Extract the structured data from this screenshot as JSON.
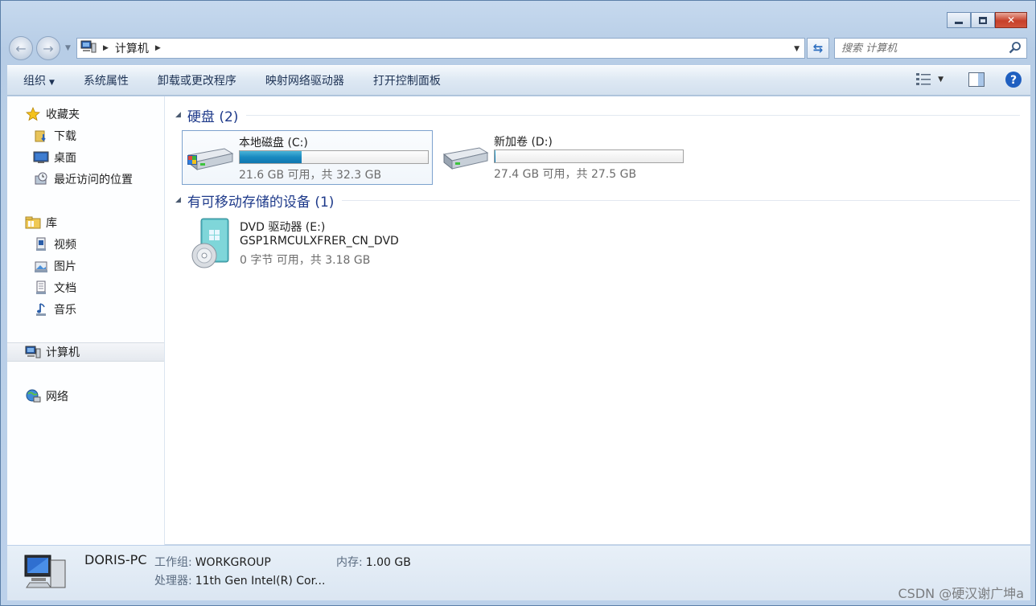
{
  "window": {
    "controls": {
      "minimize": "minimize",
      "maximize": "maximize",
      "close": "✕"
    }
  },
  "address": {
    "location": "计算机",
    "icon": "computer-icon"
  },
  "search": {
    "placeholder": "搜索 计算机"
  },
  "toolbar": {
    "organize": "组织",
    "system_properties": "系统属性",
    "uninstall": "卸载或更改程序",
    "map_drive": "映射网络驱动器",
    "control_panel": "打开控制面板"
  },
  "sidebar": {
    "favorites": {
      "label": "收藏夹",
      "icon": "star-icon"
    },
    "favorites_items": [
      {
        "label": "下载",
        "icon": "downloads-folder-icon"
      },
      {
        "label": "桌面",
        "icon": "desktop-icon"
      },
      {
        "label": "最近访问的位置",
        "icon": "recent-places-icon"
      }
    ],
    "libraries": {
      "label": "库",
      "icon": "libraries-icon"
    },
    "library_items": [
      {
        "label": "视频",
        "icon": "videos-icon"
      },
      {
        "label": "图片",
        "icon": "pictures-icon"
      },
      {
        "label": "文档",
        "icon": "documents-icon"
      },
      {
        "label": "音乐",
        "icon": "music-icon"
      }
    ],
    "computer": {
      "label": "计算机",
      "icon": "computer-icon"
    },
    "network": {
      "label": "网络",
      "icon": "network-icon"
    }
  },
  "groups": {
    "hard_disks": {
      "title": "硬盘 (2)"
    },
    "removable": {
      "title": "有可移动存储的设备 (1)"
    }
  },
  "drives": [
    {
      "name": "本地磁盘 (C:)",
      "free_text": "21.6 GB 可用，共 32.3 GB",
      "used_fraction": 0.331
    },
    {
      "name": "新加卷 (D:)",
      "free_text": "27.4 GB 可用，共 27.5 GB",
      "used_fraction": 0.004
    }
  ],
  "dvd": {
    "name": "DVD 驱动器 (E:)",
    "label": "GSP1RMCULXFRER_CN_DVD",
    "free_text": "0 字节 可用，共 3.18 GB"
  },
  "details": {
    "pc_name": "DORIS-PC",
    "workgroup_key": "工作组:",
    "workgroup_val": "WORKGROUP",
    "memory_key": "内存:",
    "memory_val": "1.00 GB",
    "cpu_key": "处理器:",
    "cpu_val": "11th Gen Intel(R) Cor..."
  },
  "watermark": "CSDN @硬汉谢广坤a",
  "colors": {
    "accent_title": "#1e3a8a",
    "bar_fill": "#1a8ac0",
    "close_button": "#c7402a"
  }
}
